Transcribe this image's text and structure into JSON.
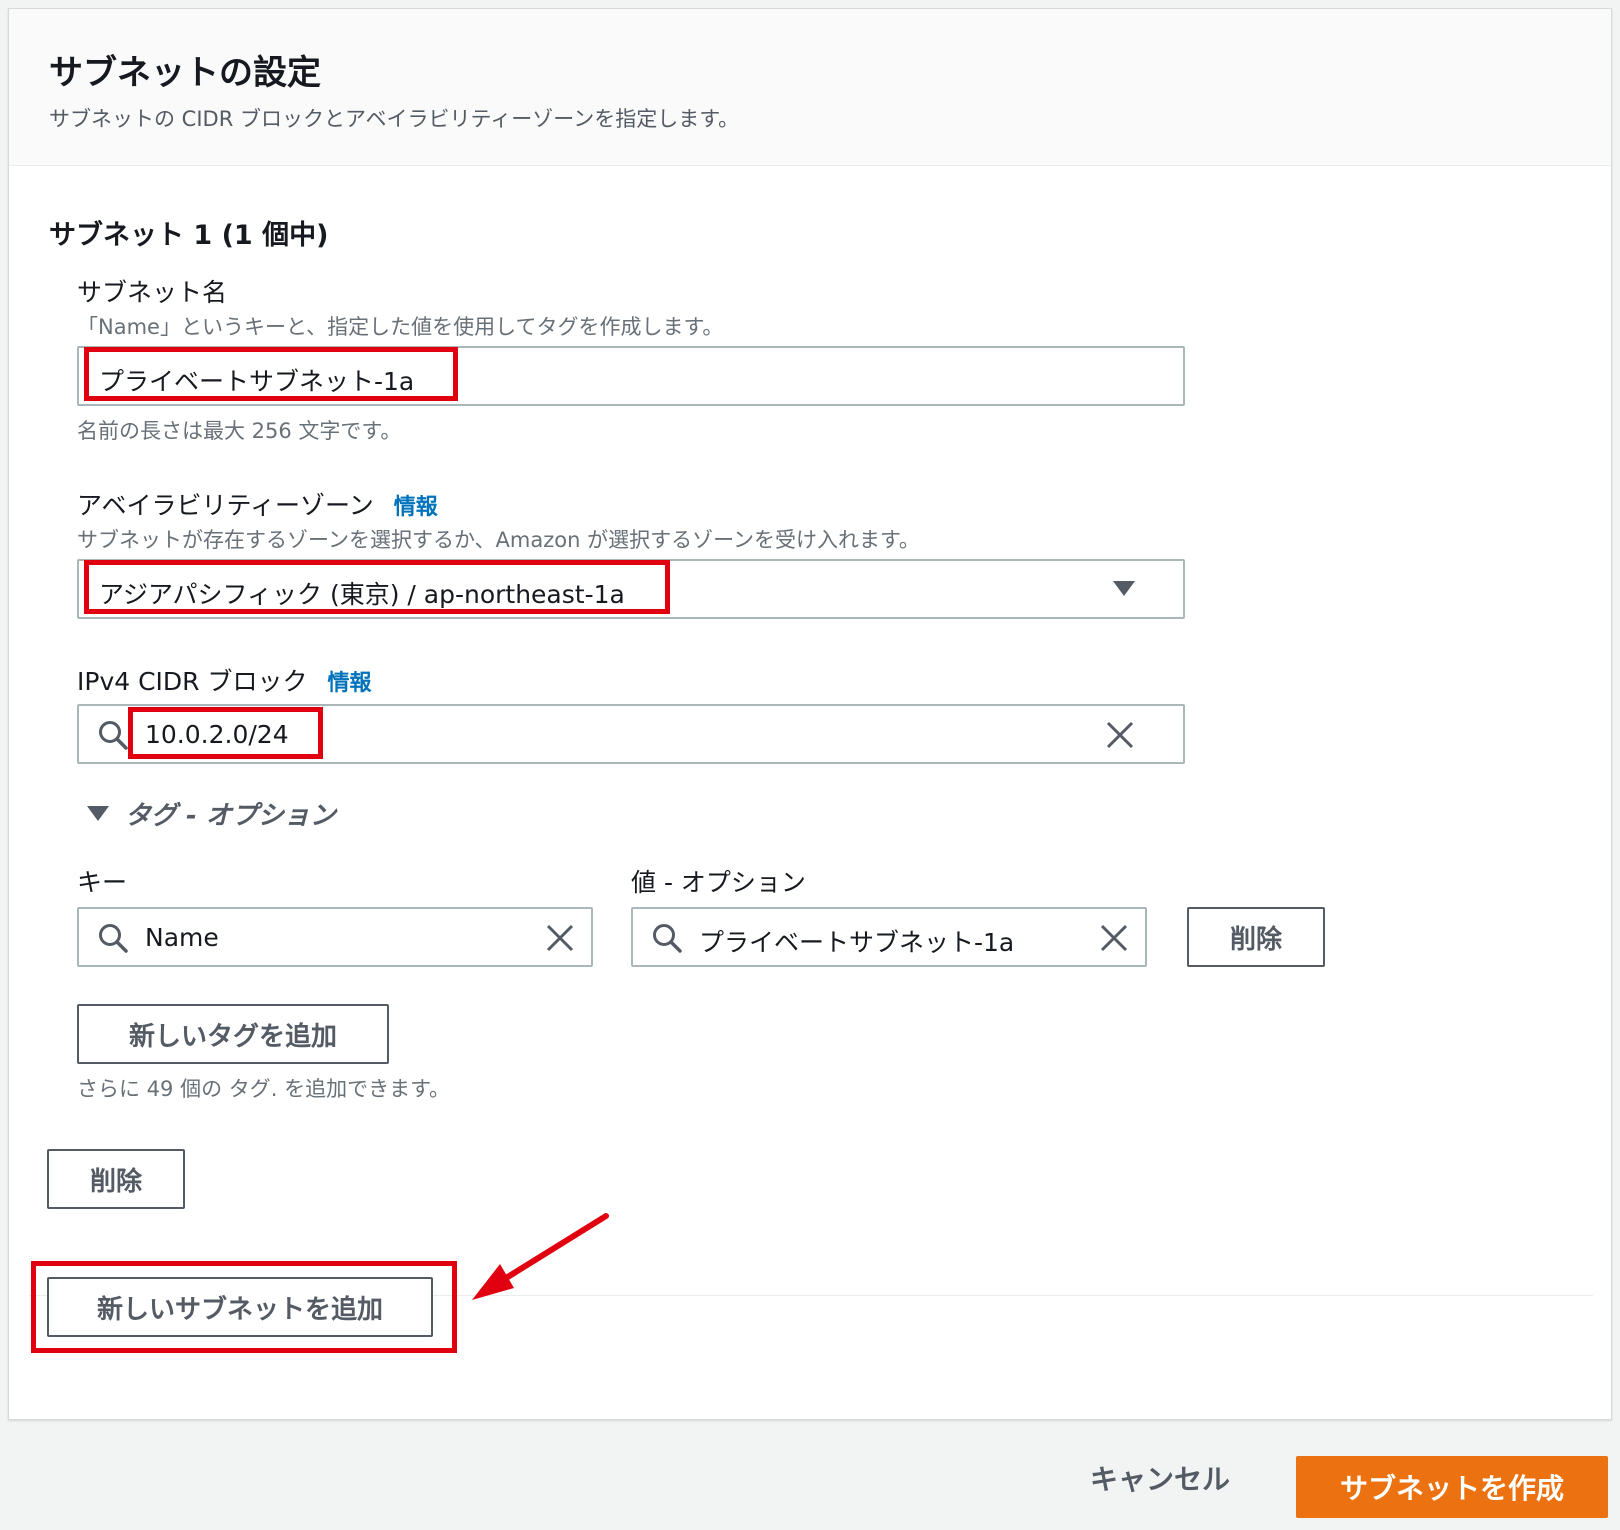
{
  "section": {
    "title": "サブネットの設定",
    "description": "サブネットの CIDR ブロックとアベイラビリティーゾーンを指定します。"
  },
  "subnet": {
    "heading": "サブネット 1 (1 個中)",
    "name": {
      "label": "サブネット名",
      "description": "「Name」というキーと、指定した値を使用してタグを作成します。",
      "value": "プライベートサブネット-1a",
      "hint": "名前の長さは最大 256 文字です。"
    },
    "az": {
      "label": "アベイラビリティーゾーン",
      "info": "情報",
      "description": "サブネットが存在するゾーンを選択するか、Amazon が選択するゾーンを受け入れます。",
      "value": "アジアパシフィック (東京) / ap-northeast-1a"
    },
    "cidr": {
      "label": "IPv4 CIDR ブロック",
      "info": "情報",
      "value": "10.0.2.0/24"
    },
    "tags": {
      "toggle_label": "タグ - オプション",
      "key_label": "キー",
      "value_label": "値 - オプション",
      "key_value": "Name",
      "value_value": "プライベートサブネット-1a",
      "remove_label": "削除",
      "add_label": "新しいタグを追加",
      "hint": "さらに 49 個の タグ. を追加できます。"
    },
    "remove_subnet_label": "削除"
  },
  "add_subnet_label": "新しいサブネットを追加",
  "footer": {
    "cancel_label": "キャンセル",
    "create_label": "サブネットを作成"
  },
  "colors": {
    "primary": "#ec7211",
    "link": "#0073bb",
    "highlight": "#e0000f"
  }
}
